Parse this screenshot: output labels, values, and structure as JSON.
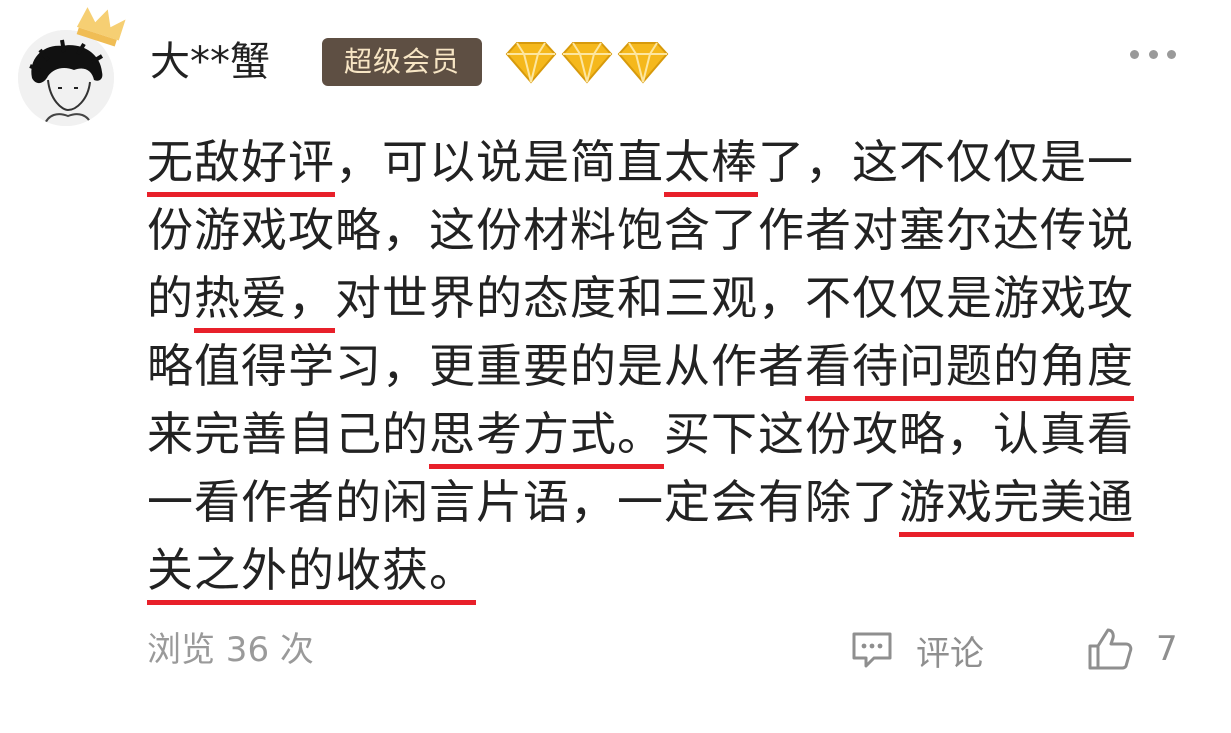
{
  "user": {
    "name": "大**蟹",
    "vip_badge": "超级会员",
    "diamond_count": 3,
    "badge_color": "#5e4f43",
    "diamond_color": "#f5b81c"
  },
  "comment": {
    "lines": [
      [
        {
          "t": "无敌好评",
          "hl": true
        },
        {
          "t": "，可以说是简直"
        },
        {
          "t": "太棒",
          "hl": true
        },
        {
          "t": "了，这不仅仅是一"
        }
      ],
      [
        {
          "t": "份游戏攻略，这份材料饱含了作者对塞尔达传说"
        }
      ],
      [
        {
          "t": "的"
        },
        {
          "t": "热爱，",
          "hl": true
        },
        {
          "t": "对世界的态度和三观，不仅仅是游戏攻"
        }
      ],
      [
        {
          "t": "略值得学习，更重要的是从作者"
        },
        {
          "t": "看待问题的角度",
          "hl": true
        }
      ],
      [
        {
          "t": "来完善自己的"
        },
        {
          "t": "思考方式。",
          "hl": true
        },
        {
          "t": "买下这份攻略，认真看"
        }
      ],
      [
        {
          "t": "一看作者的闲言片语，一定会有除了"
        },
        {
          "t": "游戏完美通",
          "hl": true
        }
      ],
      [
        {
          "t": "关之外的收获。",
          "hl": true
        }
      ]
    ],
    "underline_color": "#e8202a"
  },
  "footer": {
    "views": "浏览 36 次",
    "comment_label": "评论",
    "likes": "7"
  }
}
